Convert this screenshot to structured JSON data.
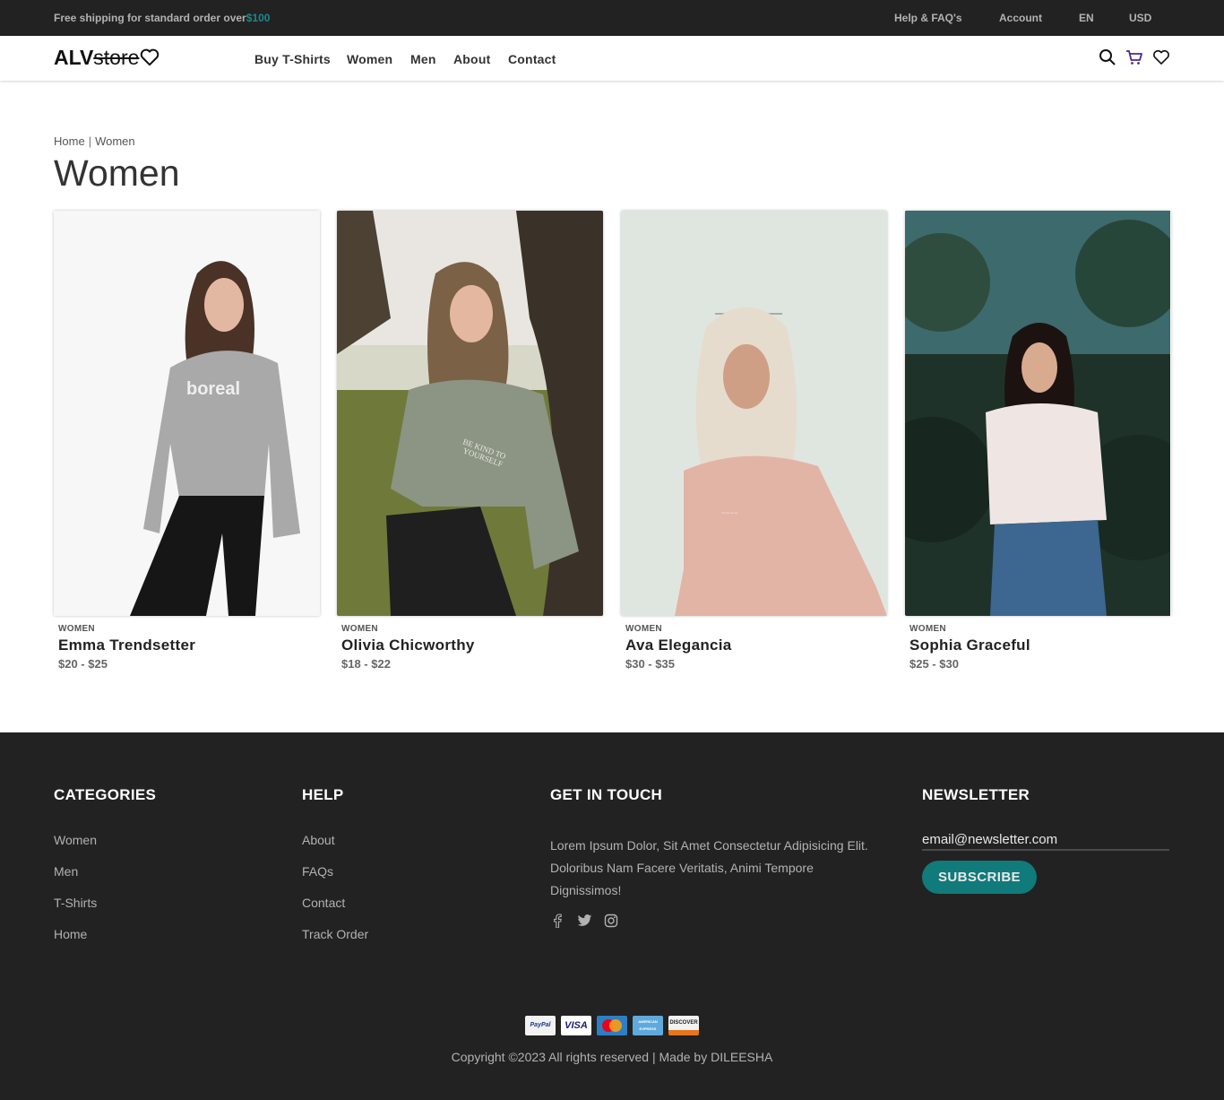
{
  "topbar": {
    "shipping_text": "Free shipping for standard order over",
    "shipping_amount": "$100",
    "links": [
      "Help & FAQ's",
      "Account",
      "EN",
      "USD"
    ]
  },
  "header": {
    "logo_bold": "ALV",
    "logo_strike": "store",
    "nav": [
      "Buy T-Shirts",
      "Women",
      "Men",
      "About",
      "Contact"
    ],
    "icons": [
      "search-icon",
      "cart-icon",
      "heart-icon"
    ]
  },
  "breadcrumb": {
    "home": "Home",
    "sep": "|",
    "current": "Women"
  },
  "page_title": "Women",
  "products": [
    {
      "category": "WOMEN",
      "name": "Emma Trendsetter",
      "price": "$20 - $25"
    },
    {
      "category": "WOMEN",
      "name": "Olivia Chicworthy",
      "price": "$18 - $22"
    },
    {
      "category": "WOMEN",
      "name": "Ava Elegancia",
      "price": "$30 - $35"
    },
    {
      "category": "WOMEN",
      "name": "Sophia Graceful",
      "price": "$25 - $30"
    }
  ],
  "footer": {
    "categories": {
      "title": "CATEGORIES",
      "links": [
        "Women",
        "Men",
        "T-Shirts",
        "Home"
      ]
    },
    "help": {
      "title": "HELP",
      "links": [
        "About",
        "FAQs",
        "Contact",
        "Track Order"
      ]
    },
    "touch": {
      "title": "GET IN TOUCH",
      "text": "Lorem Ipsum Dolor, Sit Amet Consectetur Adipisicing Elit. Doloribus Nam Facere Veritatis, Animi Tempore Dignissimos!",
      "social": [
        "facebook-icon",
        "twitter-icon",
        "instagram-icon"
      ]
    },
    "newsletter": {
      "title": "NEWSLETTER",
      "input_value": "email@newsletter.com",
      "button": "SUBSCRIBE"
    },
    "payments": [
      "PayPal",
      "VISA",
      "MasterCard",
      "AMERICAN EXPRESS",
      "DISCOVER"
    ],
    "copyright": "Copyright ©2023 All rights reserved | Made by DILEESHA"
  },
  "colors": {
    "dark": "#222222",
    "accent": "#117a7a",
    "muted": "#b2b2b2"
  }
}
